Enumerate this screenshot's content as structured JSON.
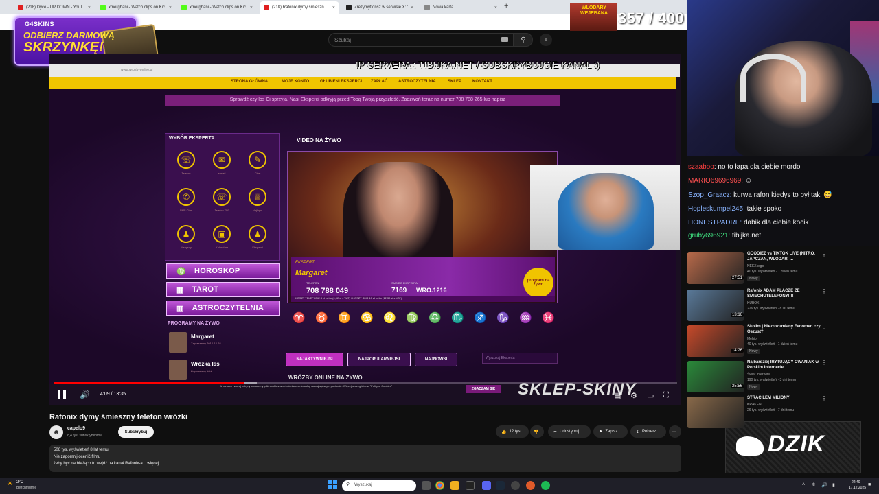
{
  "browser": {
    "tabs": [
      {
        "label": "(218) Dyce - UP DOWN - YouT",
        "active": false
      },
      {
        "label": "xmerghani - Watch clips on Kic",
        "active": false
      },
      {
        "label": "xmerghani - Watch clips on Kic",
        "active": false
      },
      {
        "label": "(218) Rafonix dymy śmieszn",
        "active": true
      },
      {
        "label": "Zrezymyflonsz w serwisie X: \"Je",
        "active": false
      },
      {
        "label": "Nowa karta",
        "active": false
      }
    ],
    "new_tab": "+"
  },
  "youtube": {
    "search_placeholder": "Szukaj"
  },
  "promo": {
    "brand": "G4SKINS",
    "line1": "ODBIERZ DARMOWĄ",
    "line2": "SKRZYNKĘ!"
  },
  "counter": {
    "label": "WLODARY WEJEBANA",
    "value": "357 / 400"
  },
  "video_content": {
    "overlay_ip": "IP SERVERA : TIBIJKA.NET / SUBSKRYBUJCIE KANAL :)",
    "inner_url": "www.wrozbyonline.pl",
    "nav": [
      "STRONA GŁÓWNA",
      "MOJE KONTO",
      "GŁUBIENI EKSPERCI",
      "ZAPŁAĆ",
      "ASTROCZYTELNIA",
      "SKLEP",
      "KONTAKT"
    ],
    "banner": "Sprawdź czy los Ci sprzyja. Nasi Eksperci odkryją przed Tobą Twoją przyszłość. Zadzwoń teraz na numer 708 788 265 lub napisz",
    "panel_title": "WYBÓR EKSPERTA",
    "panel_icons": [
      {
        "glyph": "☏",
        "label": "Telefon"
      },
      {
        "glyph": "✉",
        "label": "e-mail"
      },
      {
        "glyph": "✎",
        "label": "Chat"
      },
      {
        "glyph": "✆",
        "label": "SMS Chat"
      },
      {
        "glyph": "☏",
        "label": "Telefon 700"
      },
      {
        "glyph": "♕",
        "label": "Najlepsi"
      },
      {
        "glyph": "♟",
        "label": "Wszyscy"
      },
      {
        "glyph": "▣",
        "label": "Kalendarz"
      },
      {
        "glyph": "♟",
        "label": "Eksperci"
      }
    ],
    "menu": [
      {
        "icon": "♍",
        "label": "HOROSKOP"
      },
      {
        "icon": "▦",
        "label": "TAROT"
      },
      {
        "icon": "▥",
        "label": "ASTROCZYTELNIA"
      }
    ],
    "programs_title": "PROGRAMY NA ŻYWO",
    "programs": [
      {
        "name": "Margaret",
        "sub": "Zapraszamy 2014-12-28"
      },
      {
        "name": "Wróżka Iss",
        "sub": "Zapraszamy dziś"
      }
    ],
    "video_title": "VIDEO NA ŻYWO",
    "expert": {
      "label": "EKSPERT:",
      "name": "Margaret",
      "tel_label": "TELEFON",
      "tel": "708 788 049",
      "sms_label": "SMS DO EKSPERTA",
      "sms": "7169",
      "sms_code": "WRO.1216",
      "program_badge": "program na żywo",
      "footer": "KOSZT TELEFONU 4 zł netto (4,92 zł z VAT) / KOSZT SMS 10 zł netto (12,30 zł z VAT)"
    },
    "zodiac": [
      "♈",
      "♉",
      "♊",
      "♋",
      "♌",
      "♍",
      "♎",
      "♏",
      "♐",
      "♑",
      "♒",
      "♓"
    ],
    "pills": [
      "NAJAKTYWNIEJSI",
      "NAJPOPULARNIEJSI",
      "NAJNOWSI"
    ],
    "search_expert": "Wyszukaj Eksperta",
    "online_header": "WRÓŻBY ONLINE NA ŻYWO",
    "cookie_text": "W ramach naszej witryny stosujemy pliki cookies w celu świadczenia usług na najwyższym poziomie. Więcej szczegółów w \"Polityce Cookies\"",
    "cookie_btn": "ZGADZAM SIĘ",
    "watermark": "SKLEP-SKINY"
  },
  "player": {
    "progress_fraction": 0.306,
    "buffer_fraction": 0.326,
    "time": "4:09 / 13:35"
  },
  "video_info": {
    "title": "Rafonix dymy śmieszny telefon wróżki",
    "channel": "capelo9",
    "subs": "8,4 tys. subskrybentów",
    "subscribe": "Subskrybuj",
    "likes": "12 tys.",
    "share": "Udostępnij",
    "save": "Zapisz",
    "download": "Pobierz",
    "desc_meta": "506 tys. wyświetleń  8 lat temu",
    "desc_line1": "Nie zapomnij ocenić filmu",
    "desc_line2": "żeby być na bieżąco to wejdź na kanał Rafonix-a ...więcej"
  },
  "chat": [
    {
      "user": "szaaboo",
      "color": "#ff4040",
      "text": ": no to łapa dla ciebie mordo"
    },
    {
      "user": "MARIO69696969:",
      "color": "#ff5050",
      "text": " ☺"
    },
    {
      "user": "Szop_Graacz:",
      "color": "#8ab4ff",
      "text": " kurwa rafon kiedys to był taki 😅"
    },
    {
      "user": "Hopleskumpel245",
      "color": "#8ab4ff",
      "text": ": takie spoko"
    },
    {
      "user": "HONESTPADRE:",
      "color": "#8ab4ff",
      "text": " dabik dla ciebie kocik"
    },
    {
      "user": "gruby696921:",
      "color": "#40e080",
      "text": " tibijka.net"
    }
  ],
  "sidebar": [
    {
      "title": "GOODIEZ vs TIKTOK LIVE (NITRO, JAPCZAN, WLODAR, ...",
      "channel": "NEEXcsgo",
      "meta": "40 tys. wyświetleń · 1 dzień temu",
      "badge": "Nowy",
      "duration": "27:51",
      "color": "#b86a4a"
    },
    {
      "title": "Rafonix ADAM PLACZE ZE SMIECHUTELEFONY!!!!",
      "channel": "KUBOX",
      "meta": "226 tys. wyświetleń · 8 lat temu",
      "badge": "",
      "duration": "13:16",
      "color": "#5a7a9a"
    },
    {
      "title": "Skolim | Niezrozumiany Fenomen czy Oszust?",
      "channel": "Mehio",
      "meta": "40 tys. wyświetleń · 1 dzień temu",
      "badge": "Nowy",
      "duration": "14:26",
      "color": "#c84a2a"
    },
    {
      "title": "Najbardziej IRYTUJĄCY CWANIAK w Polskim Internecie",
      "channel": "Świat Internetu",
      "meta": "190 tys. wyświetleń · 3 dni temu",
      "badge": "Nowy",
      "duration": "25:56",
      "color": "#2a8a3a"
    },
    {
      "title": "STRACILEM MILIONY",
      "channel": "KRAKEN",
      "meta": "26 tys. wyświetleń · 7 dni temu",
      "badge": "",
      "duration": "",
      "color": "#8a6a4a"
    }
  ],
  "dzik": "DZIK",
  "taskbar": {
    "temp": "2°C",
    "weather": "Bezchmurnie",
    "search": "Wyszukaj",
    "time": "22:40",
    "date": "17.12.2025"
  }
}
